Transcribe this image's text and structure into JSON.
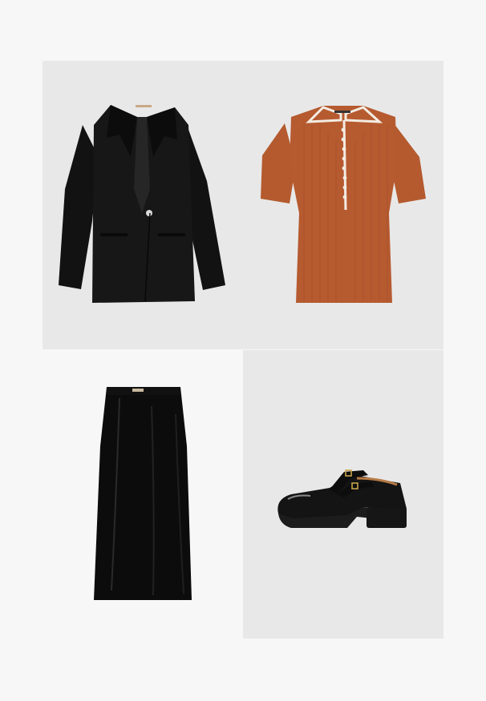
{
  "outfit": {
    "items": [
      {
        "item": "blazer",
        "color": "#151515"
      },
      {
        "item": "polo-knit-top",
        "color": "#b65a30",
        "trim_color": "#f3ece2"
      },
      {
        "item": "velvet-midi-skirt",
        "color": "#0c0c0c"
      },
      {
        "item": "patent-mary-jane-shoes",
        "color": "#141414"
      }
    ],
    "colors": {
      "page_background": "#f7f7f7",
      "tile_background": "#e8e8e8"
    }
  }
}
